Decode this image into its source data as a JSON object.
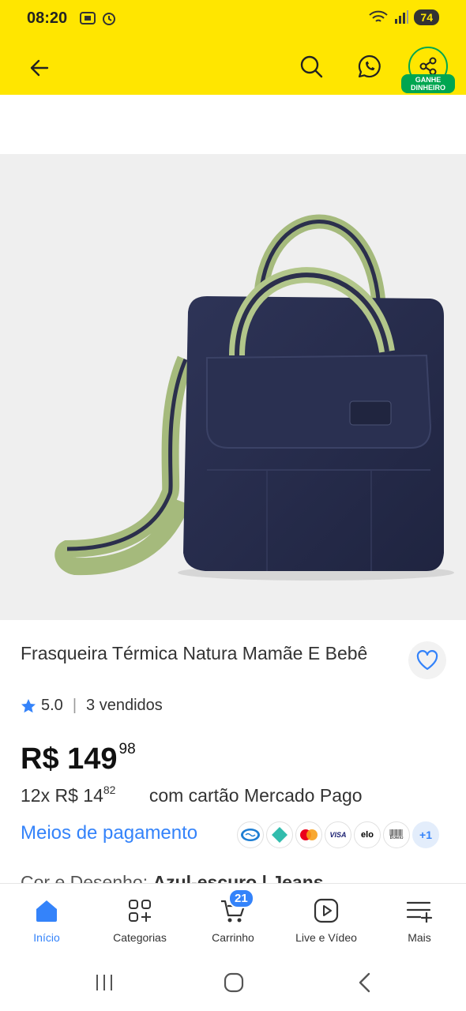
{
  "status_bar": {
    "time": "08:20",
    "battery": "74"
  },
  "header": {
    "share_badge_line1": "GANHE",
    "share_badge_line2": "DINHEIRO",
    "bg_color": "#ffe600",
    "accent_green": "#00a650"
  },
  "product": {
    "title": "Frasqueira Térmica Natura Mamãe E Bebê",
    "rating": "5.0",
    "sold": "3 vendidos",
    "price_currency_int": "R$ 149",
    "price_cents": "98",
    "installments_prefix": "12x",
    "installment_amount": "R$ 14",
    "installment_cents": "82",
    "installment_suffix": "com cartão Mercado Pago",
    "payment_link": "Meios de pagamento",
    "payment_methods": [
      "mercado-pago-icon",
      "pix-icon",
      "mastercard-icon",
      "visa-icon",
      "elo-icon",
      "boleto-icon"
    ],
    "payment_more": "+1",
    "visa_text": "VISA",
    "elo_text": "elo",
    "boleto_text": "Boleto",
    "color_label": "Cor e Desenho:",
    "color_value": "Azul-escuro | Jeans",
    "link_color": "#3483fa"
  },
  "bottom_nav": [
    {
      "label": "Início",
      "icon": "home-icon",
      "active": true
    },
    {
      "label": "Categorias",
      "icon": "categories-icon"
    },
    {
      "label": "Carrinho",
      "icon": "cart-icon",
      "badge": "21"
    },
    {
      "label": "Live e Vídeo",
      "icon": "play-icon"
    },
    {
      "label": "Mais",
      "icon": "menu-more-icon"
    }
  ]
}
